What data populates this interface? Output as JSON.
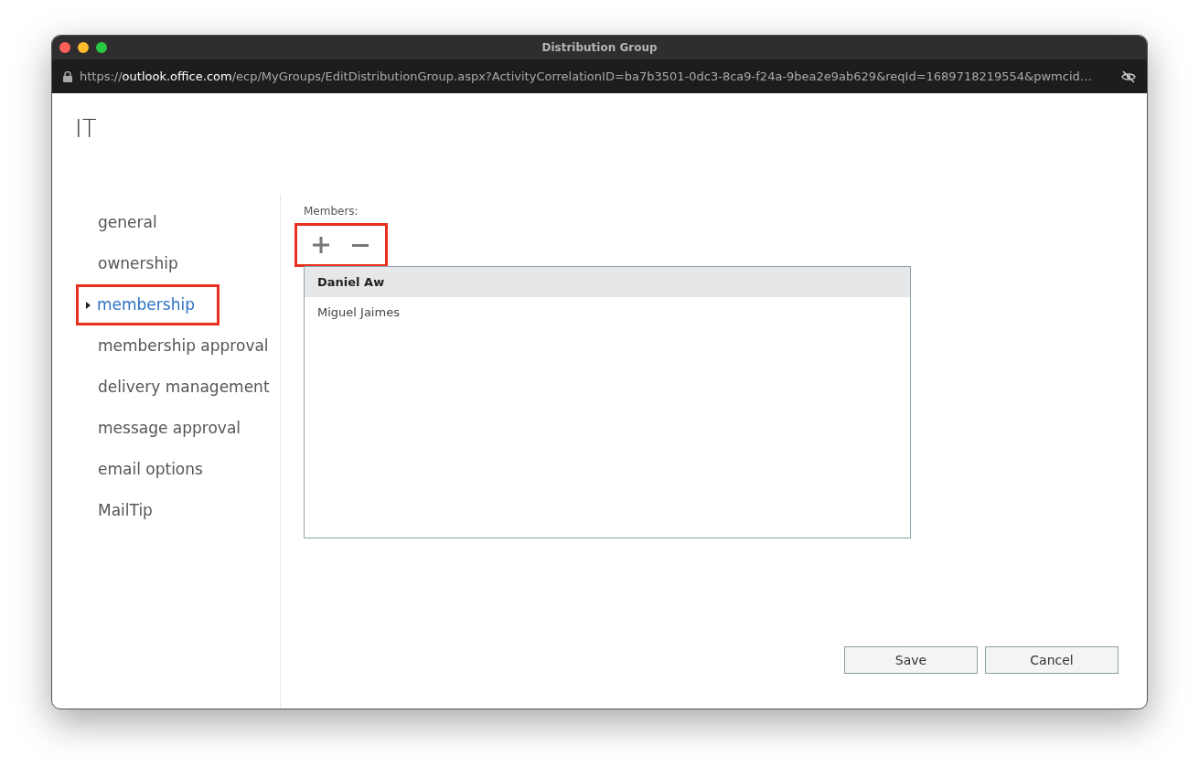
{
  "window": {
    "title": "Distribution Group"
  },
  "address_bar": {
    "scheme": "https://",
    "host": "outlook.office.com",
    "path": "/ecp/MyGroups/EditDistributionGroup.aspx?ActivityCorrelationID=ba7b3501-0dc3-8ca9-f24a-9bea2e9ab629&reqId=1689718219554&pwmcid…"
  },
  "page_title": "IT",
  "sidebar": {
    "items": [
      {
        "label": "general",
        "selected": false,
        "highlighted": false
      },
      {
        "label": "ownership",
        "selected": false,
        "highlighted": false
      },
      {
        "label": "membership",
        "selected": true,
        "highlighted": true
      },
      {
        "label": "membership approval",
        "selected": false,
        "highlighted": false
      },
      {
        "label": "delivery management",
        "selected": false,
        "highlighted": false
      },
      {
        "label": "message approval",
        "selected": false,
        "highlighted": false
      },
      {
        "label": "email options",
        "selected": false,
        "highlighted": false
      },
      {
        "label": "MailTip",
        "selected": false,
        "highlighted": false
      }
    ]
  },
  "members": {
    "label": "Members:",
    "toolbar_highlighted": true,
    "rows": [
      {
        "name": "Daniel Aw",
        "selected": true
      },
      {
        "name": "Miguel Jaimes",
        "selected": false
      }
    ]
  },
  "buttons": [
    {
      "label": "Save"
    },
    {
      "label": "Cancel"
    }
  ]
}
